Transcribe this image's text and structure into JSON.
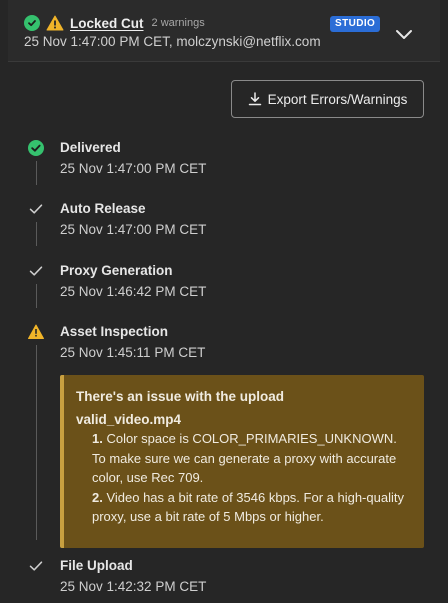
{
  "header": {
    "title": "Locked Cut",
    "warning_count": "2 warnings",
    "badge": "STUDIO",
    "meta": "25 Nov 1:47:00 PM CET, molczynski@netflix.com"
  },
  "actions": {
    "export_label": "Export Errors/Warnings"
  },
  "steps": [
    {
      "label": "Delivered",
      "time": "25 Nov 1:47:00 PM CET",
      "icon": "check-circle-icon"
    },
    {
      "label": "Auto Release",
      "time": "25 Nov 1:47:00 PM CET",
      "icon": "check-icon"
    },
    {
      "label": "Proxy Generation",
      "time": "25 Nov 1:46:42 PM CET",
      "icon": "check-icon"
    },
    {
      "label": "Asset Inspection",
      "time": "25 Nov 1:45:11 PM CET",
      "icon": "warning-icon"
    },
    {
      "label": "File Upload",
      "time": "25 Nov 1:42:32 PM CET",
      "icon": "check-icon"
    }
  ],
  "alert": {
    "title": "There's an issue with the upload",
    "file": "valid_video.mp4",
    "items": [
      {
        "num": "1.",
        "text": " Color space is COLOR_PRIMARIES_UNKNOWN. To make sure we can generate a proxy with accurate color, use Rec 709."
      },
      {
        "num": "2.",
        "text": " Video has a bit rate of 3546 kbps. For a high-quality proxy, use a bit rate of 5 Mbps or higher."
      }
    ]
  },
  "colors": {
    "background": "#262626",
    "success": "#35c16e",
    "warning": "#f0b429",
    "badge": "#2b6dd6",
    "alert_bg": "#6b5119"
  }
}
